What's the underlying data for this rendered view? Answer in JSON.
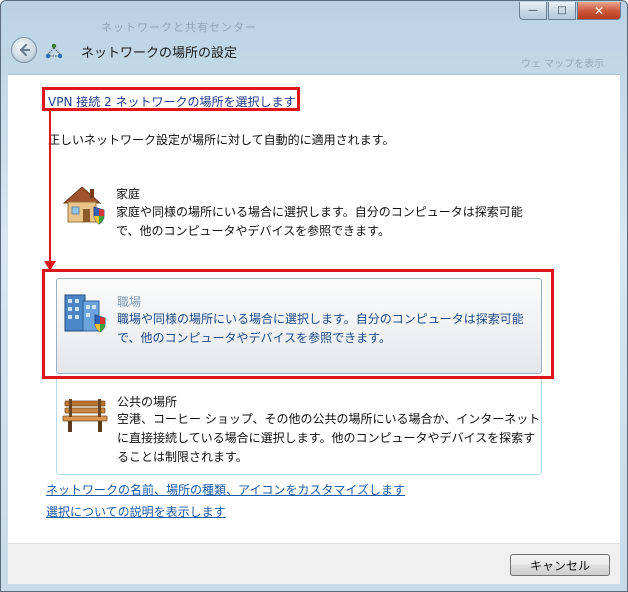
{
  "window": {
    "ghost_title": "ネットワークと共有センター",
    "ghost_text": "ウェ マップを表示",
    "controls": {
      "minimize": "—",
      "maximize": "□",
      "close": "✕"
    }
  },
  "nav": {
    "back_icon": "back-arrow-icon",
    "network_icon": "network-icon",
    "title": "ネットワークの場所の設定"
  },
  "main": {
    "heading": "VPN 接続 2 ネットワークの場所を選択します",
    "subtext": "正しいネットワーク設定が場所に対して自動的に適用されます。",
    "options": [
      {
        "id": "home",
        "icon": "house-shield-icon",
        "title": "家庭",
        "desc": "家庭や同様の場所にいる場合に選択します。自分のコンピュータは探索可能で、他のコンピュータやデバイスを参照できます。"
      },
      {
        "id": "work",
        "icon": "office-building-shield-icon",
        "title": "職場",
        "desc": "職場や同様の場所にいる場合に選択します。自分のコンピュータは探索可能で、他のコンピュータやデバイスを参照できます。"
      },
      {
        "id": "public",
        "icon": "park-bench-icon",
        "title": "公共の場所",
        "desc": "空港、コーヒー ショップ、その他の公共の場所にいる場合か、インターネットに直接接続している場合に選択します。他のコンピュータやデバイスを探索することは制限されます。"
      }
    ],
    "links": [
      "ネットワークの名前、場所の種類、アイコンをカスタマイズします",
      "選択についての説明を表示します"
    ]
  },
  "footer": {
    "cancel_label": "キャンセル"
  },
  "colors": {
    "annotation_red": "#e0141c",
    "link_blue": "#1a5aa8",
    "selected_text_blue": "#1e4b8a"
  }
}
